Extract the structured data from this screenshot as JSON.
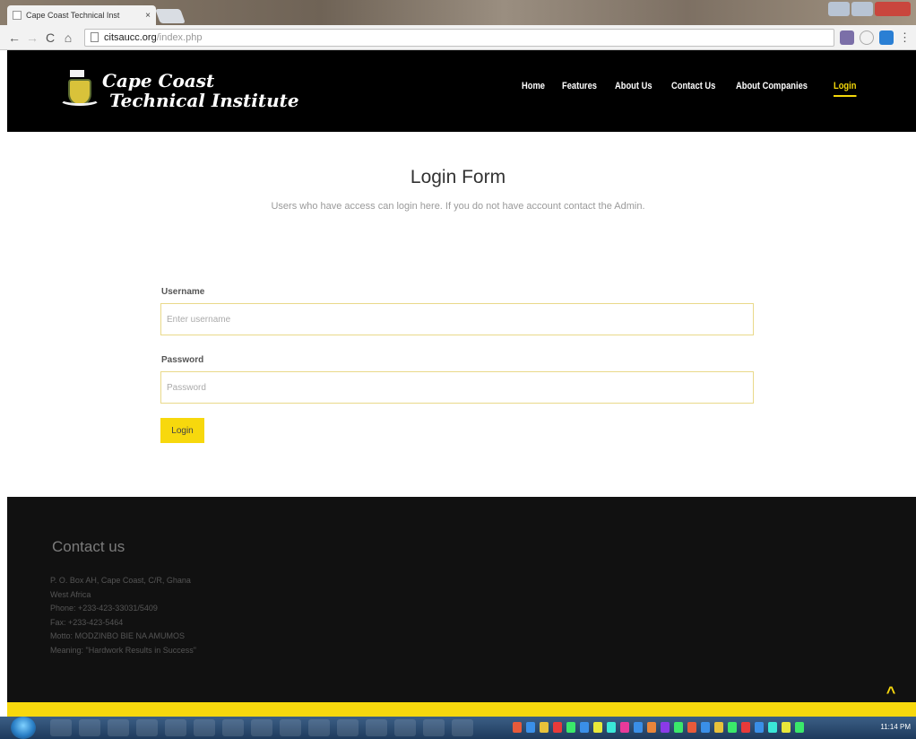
{
  "browser": {
    "tab_title": "Cape Coast Technical Inst",
    "tab_close": "×",
    "url_host": "citsaucc.org",
    "url_path": "/index.php"
  },
  "header": {
    "logo_line1": "Cape Coast",
    "logo_line2": "Technical Institute",
    "nav": [
      "Home",
      "Features",
      "About Us",
      "Contact Us",
      "About Companies",
      "Login"
    ],
    "active_nav": "Login"
  },
  "login": {
    "title": "Login Form",
    "subtitle": "Users who have access can login here. If you do not have account contact the Admin.",
    "username_label": "Username",
    "username_placeholder": "Enter username",
    "password_label": "Password",
    "password_placeholder": "Password",
    "button_label": "Login"
  },
  "footer": {
    "title": "Contact us",
    "lines": [
      "P. O. Box AH, Cape Coast, C/R, Ghana",
      "West Africa",
      "Phone: +233-423-33031/5409",
      "Fax: +233-423-5464",
      "Motto: MODZINBO BIE NA AMUMOS",
      "Meaning: \"Hardwork Results in Success\""
    ]
  },
  "taskbar": {
    "clock": "11:14 PM"
  },
  "colors": {
    "accent": "#f7d80d",
    "header_bg": "#000000",
    "footer_bg": "#111111"
  }
}
